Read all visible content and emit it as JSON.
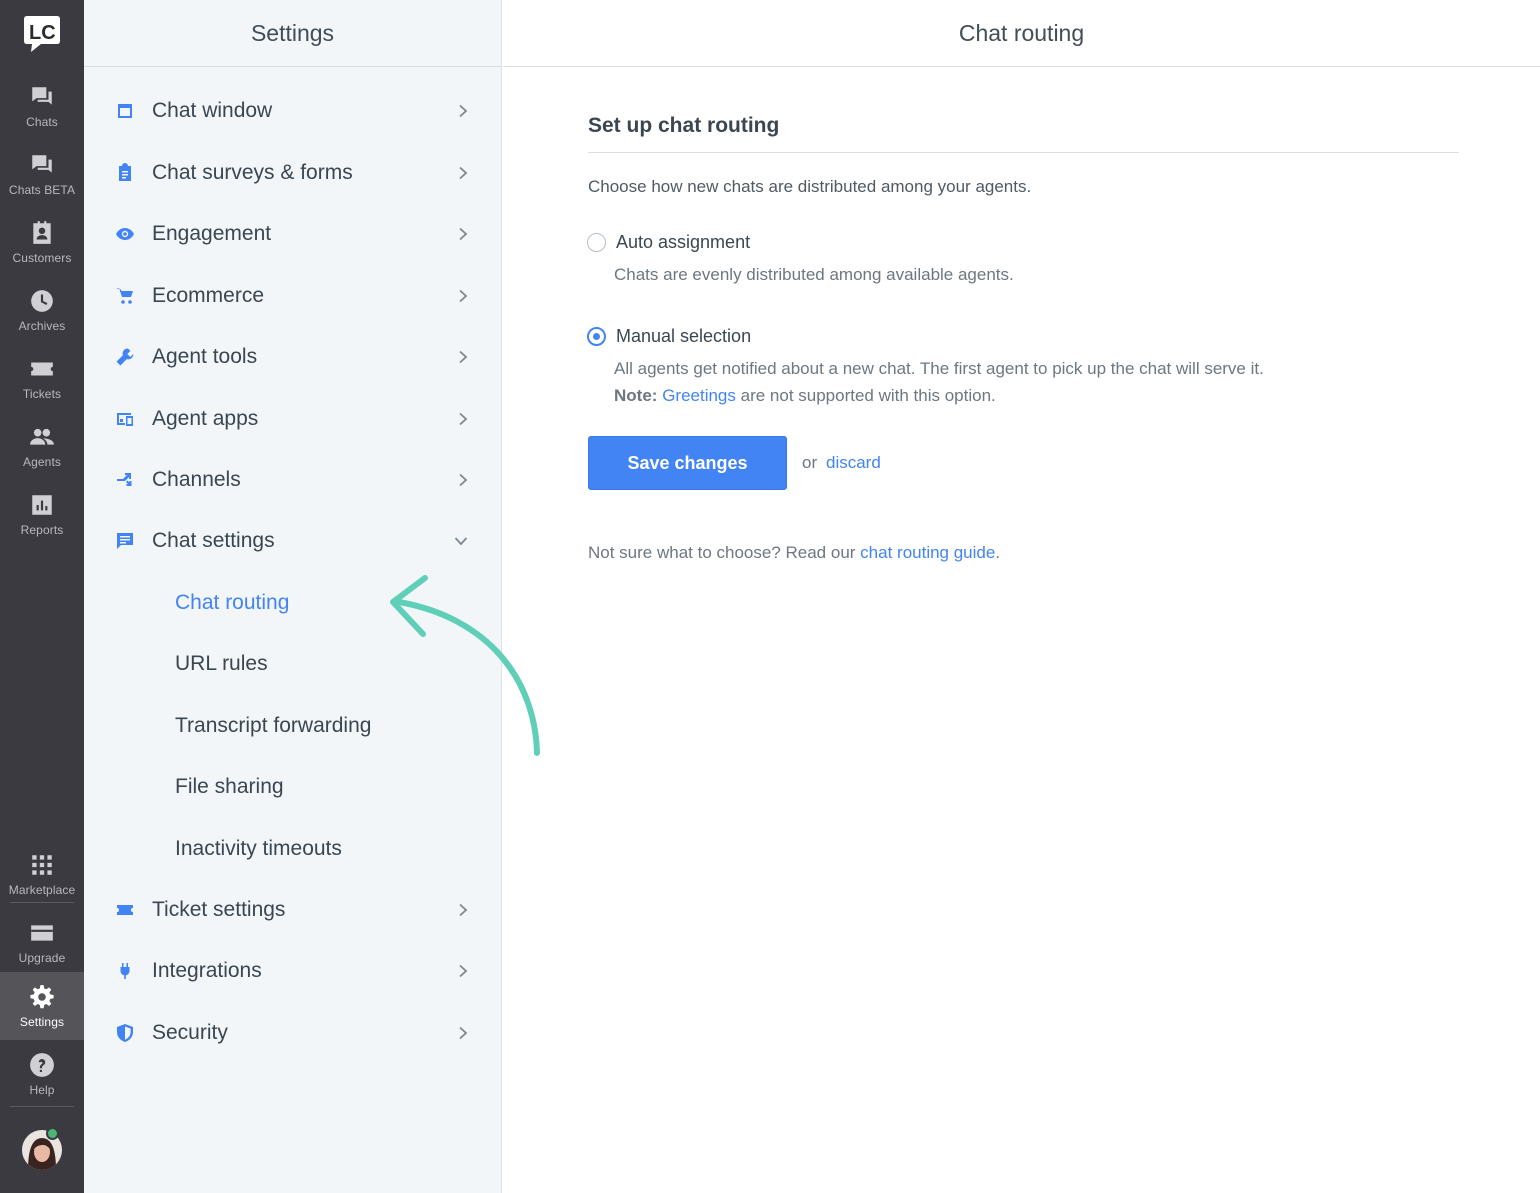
{
  "rail": {
    "logo_text": "LC",
    "items": [
      {
        "label": "Chats",
        "icon": "chat-bubbles-icon"
      },
      {
        "label": "Chats BETA",
        "icon": "chat-bubbles-icon"
      },
      {
        "label": "Customers",
        "icon": "customer-card-icon"
      },
      {
        "label": "Archives",
        "icon": "clock-icon"
      },
      {
        "label": "Tickets",
        "icon": "ticket-icon"
      },
      {
        "label": "Agents",
        "icon": "agents-icon"
      },
      {
        "label": "Reports",
        "icon": "bar-chart-icon"
      },
      {
        "label": "Marketplace",
        "icon": "grid-icon"
      },
      {
        "label": "Upgrade",
        "icon": "credit-card-icon"
      },
      {
        "label": "Settings",
        "icon": "gear-icon"
      },
      {
        "label": "Help",
        "icon": "question-icon"
      }
    ]
  },
  "settings": {
    "title": "Settings",
    "items": [
      {
        "label": "Chat window",
        "icon": "window-icon"
      },
      {
        "label": "Chat surveys & forms",
        "icon": "clipboard-icon"
      },
      {
        "label": "Engagement",
        "icon": "eye-icon"
      },
      {
        "label": "Ecommerce",
        "icon": "cart-icon"
      },
      {
        "label": "Agent tools",
        "icon": "wrench-icon"
      },
      {
        "label": "Agent apps",
        "icon": "devices-icon"
      },
      {
        "label": "Channels",
        "icon": "channels-icon"
      },
      {
        "label": "Chat settings",
        "icon": "chat-settings-icon"
      },
      {
        "label": "Ticket settings",
        "icon": "ticket-icon"
      },
      {
        "label": "Integrations",
        "icon": "plug-icon"
      },
      {
        "label": "Security",
        "icon": "shield-icon"
      }
    ],
    "subitems": [
      {
        "label": "Chat routing"
      },
      {
        "label": "URL rules"
      },
      {
        "label": "Transcript forwarding"
      },
      {
        "label": "File sharing"
      },
      {
        "label": "Inactivity timeouts"
      }
    ]
  },
  "main": {
    "title": "Chat routing",
    "section_title": "Set up chat routing",
    "intro": "Choose how new chats are distributed among your agents.",
    "option_auto": {
      "label": "Auto assignment",
      "desc": "Chats are evenly distributed among available agents."
    },
    "option_manual": {
      "label": "Manual selection",
      "desc": "All agents get notified about a new chat. The first agent to pick up the chat will serve it.",
      "note_label": "Note:",
      "note_link": "Greetings",
      "note_rest": " are not supported with this option."
    },
    "save_label": "Save changes",
    "or_text": "or",
    "discard_label": "discard",
    "guide_prefix": "Not sure what to choose? Read our ",
    "guide_link": "chat routing guide",
    "guide_suffix": "."
  },
  "colors": {
    "accent": "#4384f5",
    "rail_bg": "#3a3a40",
    "arrow": "#5fcfb7",
    "status_online": "#4bb678"
  }
}
